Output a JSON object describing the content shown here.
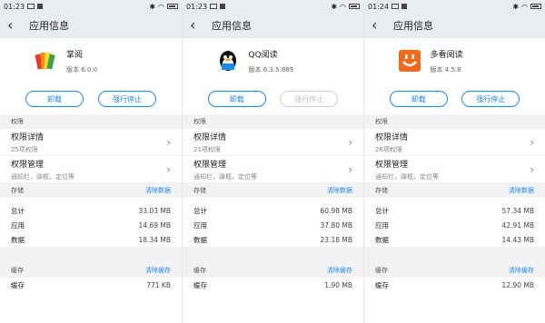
{
  "common": {
    "page_title": "应用信息",
    "permissions_section": "权限",
    "perm_details_title": "权限详情",
    "perm_manage_title": "权限管理",
    "perm_manage_sub": "通知栏，弹框，定位等",
    "uninstall": "卸载",
    "force_stop": "强行停止",
    "storage_section": "存储",
    "clear_data": "清除数据",
    "total": "总计",
    "app": "应用",
    "data": "数据",
    "cache_section": "缓存",
    "clear_cache": "清除缓存",
    "cache": "缓存"
  },
  "colors": {
    "accent": "#1e88e5",
    "header_bg": "#e9ecf0",
    "section_bg": "#f2f2f2"
  },
  "panels": [
    {
      "time": "01:23",
      "app_name": "掌阅",
      "version": "版本 6.0.0",
      "perm_count": "25项权限",
      "stop_enabled": true,
      "total": "33.03 MB",
      "app": "14.69 MB",
      "data": "18.34 MB",
      "cache": "771 KB",
      "icon": "books-stack-icon"
    },
    {
      "time": "01:23",
      "app_name": "QQ阅读",
      "version": "版本 6.3.5.889",
      "perm_count": "21项权限",
      "stop_enabled": false,
      "total": "60.98 MB",
      "app": "37.80 MB",
      "data": "23.18 MB",
      "cache": "1.90 MB",
      "icon": "qq-penguin-icon"
    },
    {
      "time": "01:24",
      "app_name": "多看阅读",
      "version": "版本 4.5.8",
      "perm_count": "26项权限",
      "stop_enabled": true,
      "total": "57.34 MB",
      "app": "42.91 MB",
      "data": "14.43 MB",
      "cache": "12.90 MB",
      "icon": "smile-face-icon"
    }
  ]
}
